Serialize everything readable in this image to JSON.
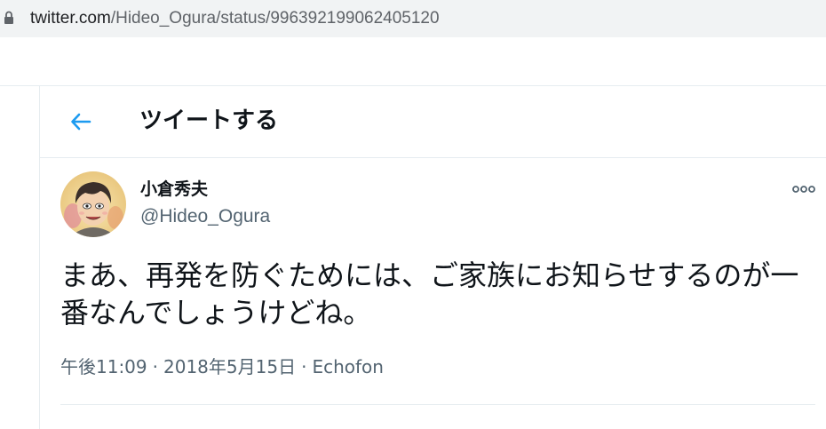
{
  "browser": {
    "url_domain": "twitter.com",
    "url_path": "/Hideo_Ogura/status/996392199062405120",
    "lock_icon": "lock-icon"
  },
  "header": {
    "title": "ツイートする",
    "back_icon": "arrow-left-icon",
    "accent_color": "#1d9bf0"
  },
  "tweet": {
    "display_name": "小倉秀夫",
    "handle": "@Hideo_Ogura",
    "text": "まあ、再発を防ぐためには、ご家族にお知らせするのが一番なんでしょうけどね。",
    "time": "午後11:09",
    "date": "2018年5月15日",
    "source": "Echofon",
    "separator": "·",
    "more_icon": "more-horizontal-icon"
  },
  "colors": {
    "text_primary": "#0f1419",
    "text_secondary": "#536471",
    "border": "#e6ecf0"
  }
}
